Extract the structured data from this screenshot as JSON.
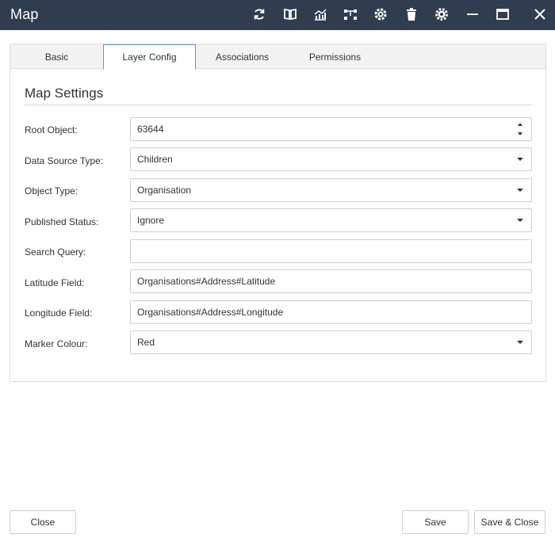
{
  "window": {
    "title": "Map",
    "toolbar_icons": [
      "refresh-icon",
      "book-icon",
      "chart-icon",
      "hierarchy-icon",
      "settings-cog-icon",
      "delete-icon",
      "gear-icon",
      "minimize-icon",
      "maximize-icon",
      "close-icon"
    ]
  },
  "tabs": [
    {
      "label": "Basic",
      "active": false
    },
    {
      "label": "Layer Config",
      "active": true
    },
    {
      "label": "Associations",
      "active": false
    },
    {
      "label": "Permissions",
      "active": false
    }
  ],
  "section": {
    "title": "Map Settings"
  },
  "form": {
    "root_object": {
      "label": "Root Object:",
      "value": "63644"
    },
    "data_source_type": {
      "label": "Data Source Type:",
      "value": "Children"
    },
    "object_type": {
      "label": "Object Type:",
      "value": "Organisation"
    },
    "published_status": {
      "label": "Published Status:",
      "value": "Ignore"
    },
    "search_query": {
      "label": "Search Query:",
      "value": ""
    },
    "latitude_field": {
      "label": "Latitude Field:",
      "value": "Organisations#Address#Latitude"
    },
    "longitude_field": {
      "label": "Longitude Field:",
      "value": "Organisations#Address#Longitude"
    },
    "marker_colour": {
      "label": "Marker Colour:",
      "value": "Red"
    }
  },
  "footer": {
    "close_label": "Close",
    "save_label": "Save",
    "save_close_label": "Save & Close"
  },
  "colors": {
    "titlebar": "#2f3d4f",
    "active_tab_border": "#5b9bd5"
  }
}
